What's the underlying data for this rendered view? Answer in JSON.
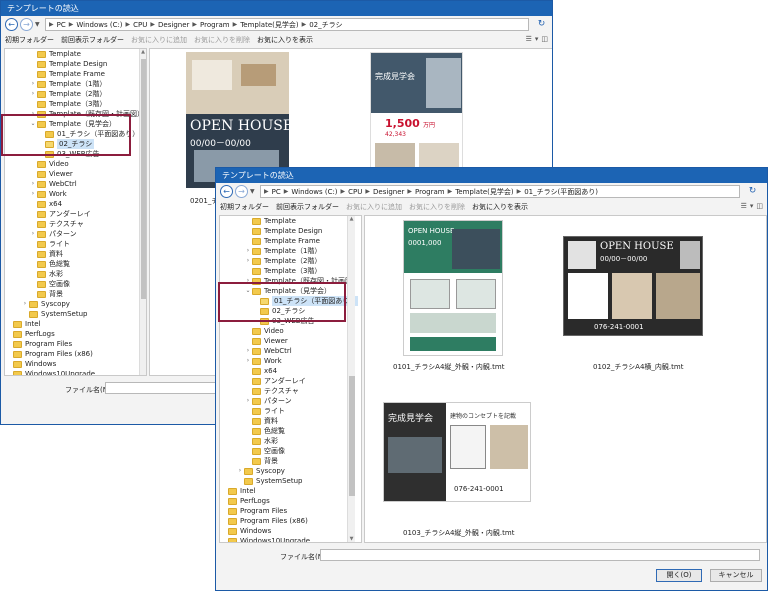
{
  "colors": {
    "title_bar": "#1c64b4",
    "highlight_box": "#8c1d3d",
    "selection": "#cde3f7",
    "folder": "#f2c94c"
  },
  "back_window": {
    "title": "テンプレートの読込",
    "breadcrumb": [
      "PC",
      "Windows (C:)",
      "CPU",
      "Designer",
      "Program",
      "Template(見学会)",
      "02_チラシ"
    ],
    "toolbar": {
      "initial_folder": "初期フォルダー",
      "prev_folder": "前回表示フォルダー",
      "add_fav": "お気に入りに追加",
      "remove_fav": "お気に入りを削除",
      "show_fav": "お気に入りを表示"
    },
    "tree": [
      "Template",
      "Template Design",
      "Template Frame",
      "Template（1階）",
      "Template（2階）",
      "Template（3階）",
      "Template（既存図・計画図）",
      "Template（見学会）",
      "01_チラシ（平面図あり）",
      "02_チラシ",
      "03_WEB広告",
      "Video",
      "Viewer",
      "WebCtrl",
      "Work",
      "x64",
      "アンダーレイ",
      "テクスチャ",
      "パターン",
      "ライト",
      "資料",
      "色総覧",
      "水彩",
      "空画像",
      "背景",
      "Syscopy",
      "SystemSetup",
      "Intel",
      "PerfLogs",
      "Program Files",
      "Program Files (x86)",
      "Windows",
      "Windows10Upgrade"
    ],
    "file_caption": "0201_チラ",
    "filename_label": "ファイル名(N):",
    "flyer1": {
      "heading": "OPEN HOUSE",
      "date": "00/00－00/00"
    },
    "flyer2": {
      "heading": "完成見学会",
      "price": "1,500",
      "unit": "万円",
      "sub": "42,343"
    }
  },
  "front_window": {
    "title": "テンプレートの読込",
    "breadcrumb": [
      "PC",
      "Windows (C:)",
      "CPU",
      "Designer",
      "Program",
      "Template(見学会)",
      "01_チラシ(平面図あり)"
    ],
    "toolbar": {
      "initial_folder": "初期フォルダー",
      "prev_folder": "前回表示フォルダー",
      "add_fav": "お気に入りに追加",
      "remove_fav": "お気に入りを削除",
      "show_fav": "お気に入りを表示"
    },
    "tree": [
      "Template",
      "Template Design",
      "Template Frame",
      "Template（1階）",
      "Template（2階）",
      "Template（3階）",
      "Template（既存図・計画図）",
      "Template（見学会）",
      "01_チラシ（平面図あり）",
      "02_チラシ",
      "03_WEB広告",
      "Video",
      "Viewer",
      "WebCtrl",
      "Work",
      "x64",
      "アンダーレイ",
      "テクスチャ",
      "パターン",
      "ライト",
      "資料",
      "色総覧",
      "水彩",
      "空画像",
      "背景",
      "Syscopy",
      "SystemSetup",
      "Intel",
      "PerfLogs",
      "Program Files",
      "Program Files (x86)",
      "Windows",
      "Windows10Upgrade"
    ],
    "files": [
      {
        "caption": "0101_チラシA4縦_外観・内観.tmt",
        "heading": "OPEN HOUSE",
        "price": "0001,000"
      },
      {
        "caption": "0102_チラシA4横_内観.tmt",
        "heading": "OPEN HOUSE",
        "date": "00/00－00/00"
      },
      {
        "caption": "0103_チラシA4縦_外観・内観.tmt",
        "heading": "完成見学会",
        "sub": "建物のコンセプトを記載",
        "phone": "076-241-0001"
      }
    ],
    "phone_front2": "076-241-0001",
    "filename_label": "ファイル名(N):",
    "open_button": "開く(O)",
    "cancel_button": "キャンセル"
  }
}
